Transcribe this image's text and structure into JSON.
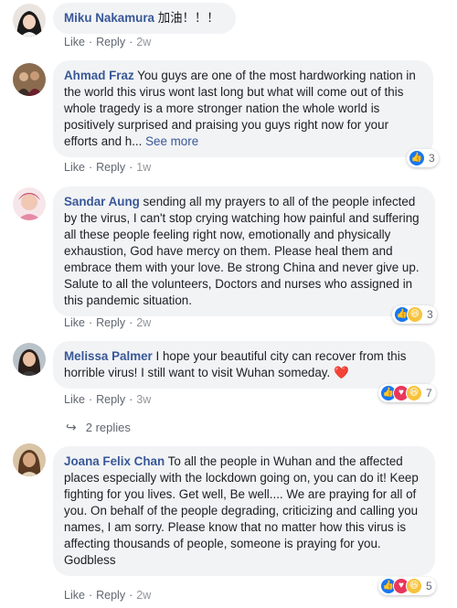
{
  "labels": {
    "like": "Like",
    "reply": "Reply",
    "dot": "·"
  },
  "comments": [
    {
      "author": "Miku Nakamura",
      "text": " 加油！！！",
      "time": "2w"
    },
    {
      "author": "Ahmad Fraz",
      "text": " You guys are one of the most hardworking nation in the world this virus wont last long but what will come out of this whole tragedy is a more stronger nation the whole world is positively surprised and praising you guys right now for your efforts and h...",
      "see_more": "See more",
      "time": "1w",
      "reactions": {
        "types": [
          "like-icon"
        ],
        "count": "3"
      }
    },
    {
      "author": "Sandar Aung",
      "text": " sending all my prayers to all of the people infected by the virus, I can't stop crying watching how painful and suffering all these people feeling right now, emotionally and physically exhaustion, God have mercy on them. Please heal them and embrace them with your love. Be strong China and never give up. Salute to all the volunteers, Doctors and nurses who assigned in this pandemic situation.",
      "time": "2w",
      "reactions": {
        "types": [
          "like-icon",
          "haha-icon"
        ],
        "count": "3"
      }
    },
    {
      "author": "Melissa Palmer",
      "text": " I hope your beautiful city can recover from this horrible virus! I still want to visit Wuhan someday.",
      "emoji": "❤️",
      "time": "3w",
      "reactions": {
        "types": [
          "like-icon",
          "love-icon",
          "haha-icon"
        ],
        "count": "7"
      },
      "replies": "2 replies"
    },
    {
      "author": "Joana Felix Chan",
      "text": " To all the people in Wuhan and the affected places especially with the lockdown going on, you can do it! Keep fighting for you lives. Get well, Be well.... We are praying for all of you. On behalf of the people degrading, criticizing and calling you names, I am sorry. Please know that no matter how this virus is affecting thousands of people, someone is praying for you.",
      "closing": "Godbless",
      "time": "2w",
      "reactions": {
        "types": [
          "like-icon",
          "love-icon",
          "haha-icon"
        ],
        "count": "5"
      }
    }
  ]
}
